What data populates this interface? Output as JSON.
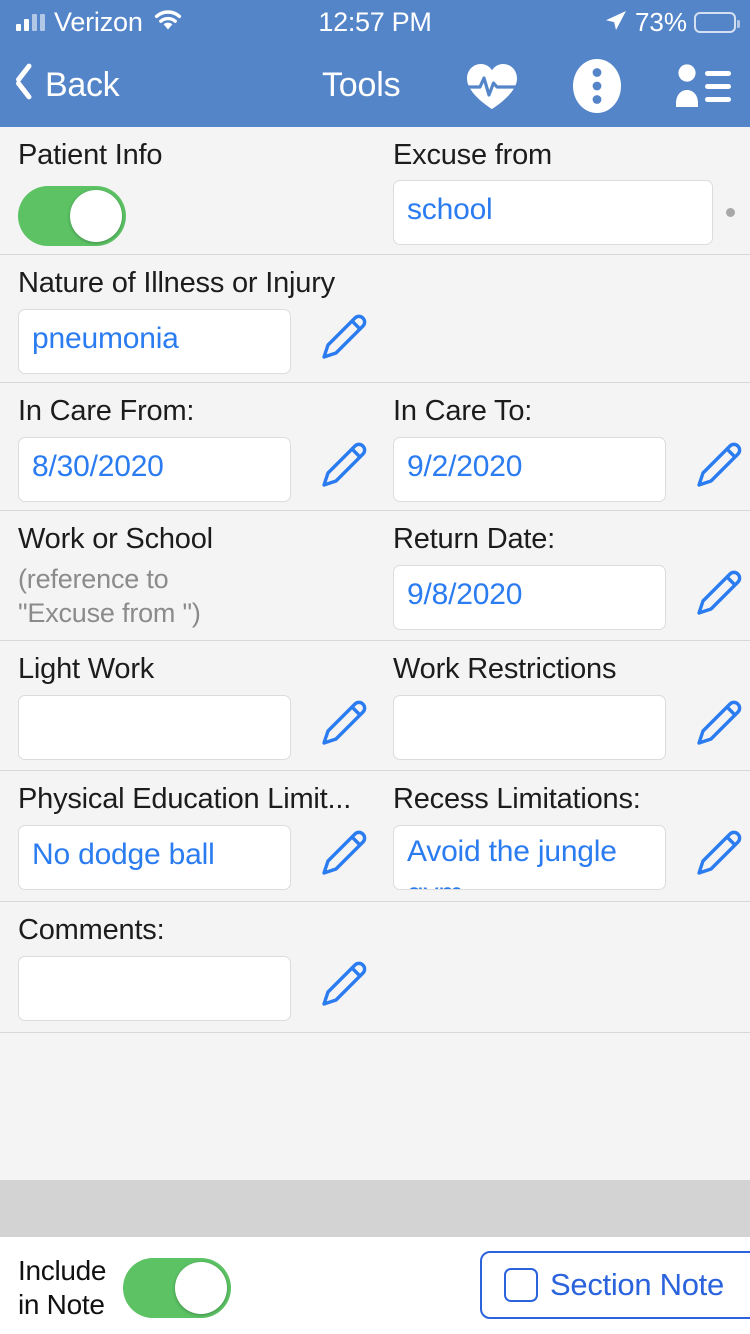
{
  "status_bar": {
    "carrier": "Verizon",
    "time": "12:57 PM",
    "battery_percent": "73%",
    "icons": [
      "signal-bars-icon",
      "wifi-icon",
      "location-arrow-icon",
      "battery-icon"
    ]
  },
  "nav_bar": {
    "back_label": "Back",
    "title": "Tools",
    "icons": [
      "heart-pulse-icon",
      "more-options-icon",
      "patient-list-icon"
    ]
  },
  "form": {
    "patient_info": {
      "label": "Patient Info",
      "toggle_on": true
    },
    "excuse_from": {
      "label": "Excuse from",
      "value": "school"
    },
    "nature_of_illness": {
      "label": "Nature of Illness or Injury",
      "value": "pneumonia"
    },
    "in_care_from": {
      "label": "In Care From:",
      "value": "8/30/2020"
    },
    "in_care_to": {
      "label": "In Care To:",
      "value": "9/2/2020"
    },
    "work_or_school": {
      "label": "Work or School",
      "sub_line1": "(reference to",
      "sub_line2": "\"Excuse from \")"
    },
    "return_date": {
      "label": "Return Date:",
      "value": "9/8/2020"
    },
    "light_work": {
      "label": "Light Work",
      "value": ""
    },
    "work_restrictions": {
      "label": "Work Restrictions",
      "value": ""
    },
    "physical_education": {
      "label": "Physical Education Limit...",
      "value": "No dodge ball"
    },
    "recess_limitations": {
      "label": "Recess Limitations:",
      "value": "Avoid the jungle gym"
    },
    "comments": {
      "label": "Comments:",
      "value": ""
    }
  },
  "bottom_bar": {
    "include_line1": "Include",
    "include_line2": "in Note",
    "include_toggle_on": true,
    "section_note_label": "Section Note",
    "section_note_checked": false
  },
  "colors": {
    "nav_blue": "#5585c9",
    "link_blue": "#2b7cf0",
    "toggle_green": "#5cc264",
    "button_blue": "#2b63dd",
    "page_bg": "#f4f4f4",
    "band_gray": "#d3d3d3"
  }
}
